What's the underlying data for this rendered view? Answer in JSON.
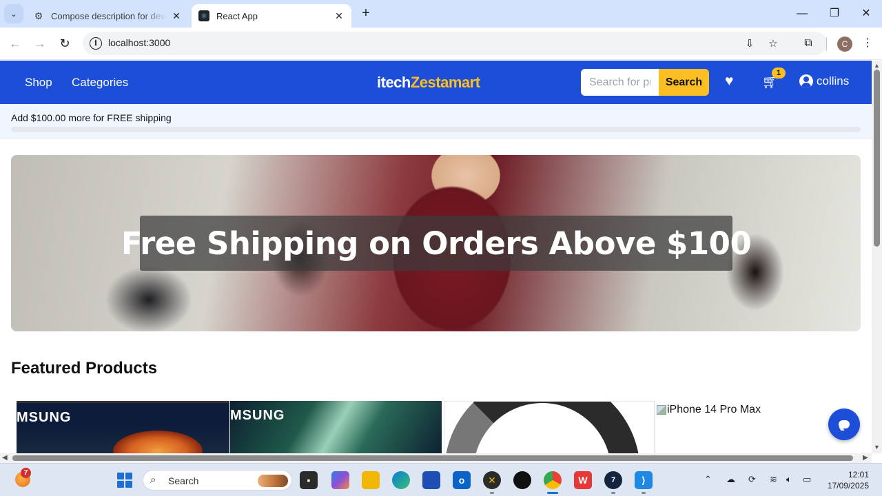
{
  "browser": {
    "tabs": [
      {
        "title": "Compose description for devel",
        "favicon": "openai-icon",
        "active": false
      },
      {
        "title": "React App",
        "favicon": "react-icon",
        "active": true
      }
    ],
    "address": "localhost:3000",
    "profile_initial": "C"
  },
  "header": {
    "nav": [
      "Shop",
      "Categories"
    ],
    "logo_part1": "itech",
    "logo_part2": "Zestamart",
    "search_placeholder": "Search for products",
    "search_button": "Search",
    "cart_count": "1",
    "username": "collins",
    "colors": {
      "brand": "#1d4ed8",
      "accent": "#fbbf24"
    }
  },
  "shipping": {
    "message": "Add $100.00 more for FREE shipping",
    "progress_fraction": 0
  },
  "banner": {
    "title": "Free Shipping on Orders Above $100"
  },
  "featured": {
    "title": "Featured Products",
    "products": [
      {
        "brand_text": "MSUNG"
      },
      {
        "brand_text": "MSUNG"
      },
      {
        "brand_text": ""
      },
      {
        "alt_text": "iPhone 14 Pro Max"
      }
    ]
  },
  "taskbar": {
    "weather_badge": "7",
    "search_label": "Search",
    "time": "12:01",
    "date": "17/09/2025"
  }
}
